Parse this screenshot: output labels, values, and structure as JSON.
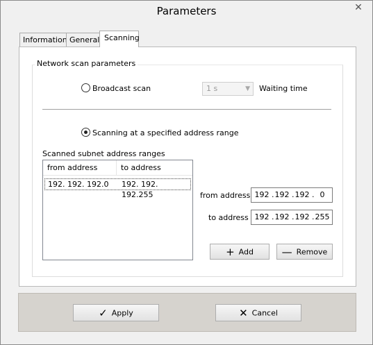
{
  "window": {
    "title": "Parameters",
    "close_glyph": "✕"
  },
  "tabs": [
    {
      "label": "Information",
      "active": false
    },
    {
      "label": "General",
      "active": false
    },
    {
      "label": "Scanning",
      "active": true
    }
  ],
  "group": {
    "label": "Network scan parameters"
  },
  "broadcast": {
    "label": "Broadcast scan",
    "selected": false
  },
  "waiting": {
    "select_value": "1 s",
    "label": "Waiting time"
  },
  "range_scan": {
    "label": "Scanning at a specified address range",
    "selected": true
  },
  "subnets": {
    "label": "Scanned subnet address ranges",
    "columns": [
      "from address",
      "to address"
    ],
    "rows": [
      {
        "from": "192. 192. 192.0",
        "to": "192. 192. 192.255"
      }
    ]
  },
  "from_field": {
    "label": "from address",
    "octets": [
      "192",
      "192",
      "192",
      "0"
    ]
  },
  "to_field": {
    "label": "to address",
    "octets": [
      "192",
      "192",
      "192",
      "255"
    ]
  },
  "buttons": {
    "add": "Add",
    "remove": "Remove",
    "apply": "Apply",
    "cancel": "Cancel"
  },
  "icons": {
    "add": "plus-icon",
    "remove": "minus-icon",
    "apply": "checkmark-icon",
    "cancel": "x-icon"
  }
}
